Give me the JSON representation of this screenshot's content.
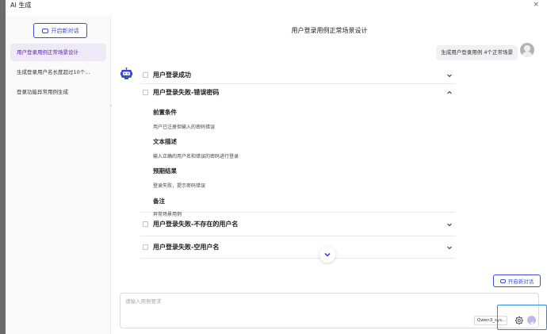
{
  "window": {
    "title": "AI 生成",
    "close_glyph": "×"
  },
  "sidebar": {
    "new_chat_label": "开启新对话",
    "sessions": [
      {
        "label": "用户登录用例正常场景设计",
        "active": true
      },
      {
        "label": "生成登录用户名长度超过10个...",
        "active": false
      },
      {
        "label": "登录功能异常用例生成",
        "active": false
      }
    ]
  },
  "conversation": {
    "title": "用户登录用例正常场景设计",
    "user_message": "生成用户登录用例 4个正常场景",
    "cases": [
      {
        "name": "用户登录成功",
        "expanded": false
      },
      {
        "name": "用户登录失败-错误密码",
        "expanded": true
      },
      {
        "name": "用户登录失败-不存在的用户名",
        "expanded": false
      },
      {
        "name": "用户登录失败-空用户名",
        "expanded": false
      }
    ],
    "detail": {
      "precondition_label": "前置条件",
      "precondition_text": "用户已注册但输入的密码错误",
      "description_label": "文本描述",
      "description_text": "输入正确的用户名和错误的密码进行登录",
      "expected_label": "预期结果",
      "expected_text": "登录失败，提示密码错误",
      "remark_label": "备注",
      "remark_text": "异常场景用例"
    }
  },
  "composer": {
    "new_chat_label": "开启新对话",
    "placeholder": "请输入用例要求",
    "model": "Qwen3_sys..."
  },
  "colors": {
    "accent": "#3d4bd6",
    "active_session_bg": "#efe9f7",
    "send_button": "#c5b3ea",
    "highlight_box": "#2b8ce6"
  }
}
